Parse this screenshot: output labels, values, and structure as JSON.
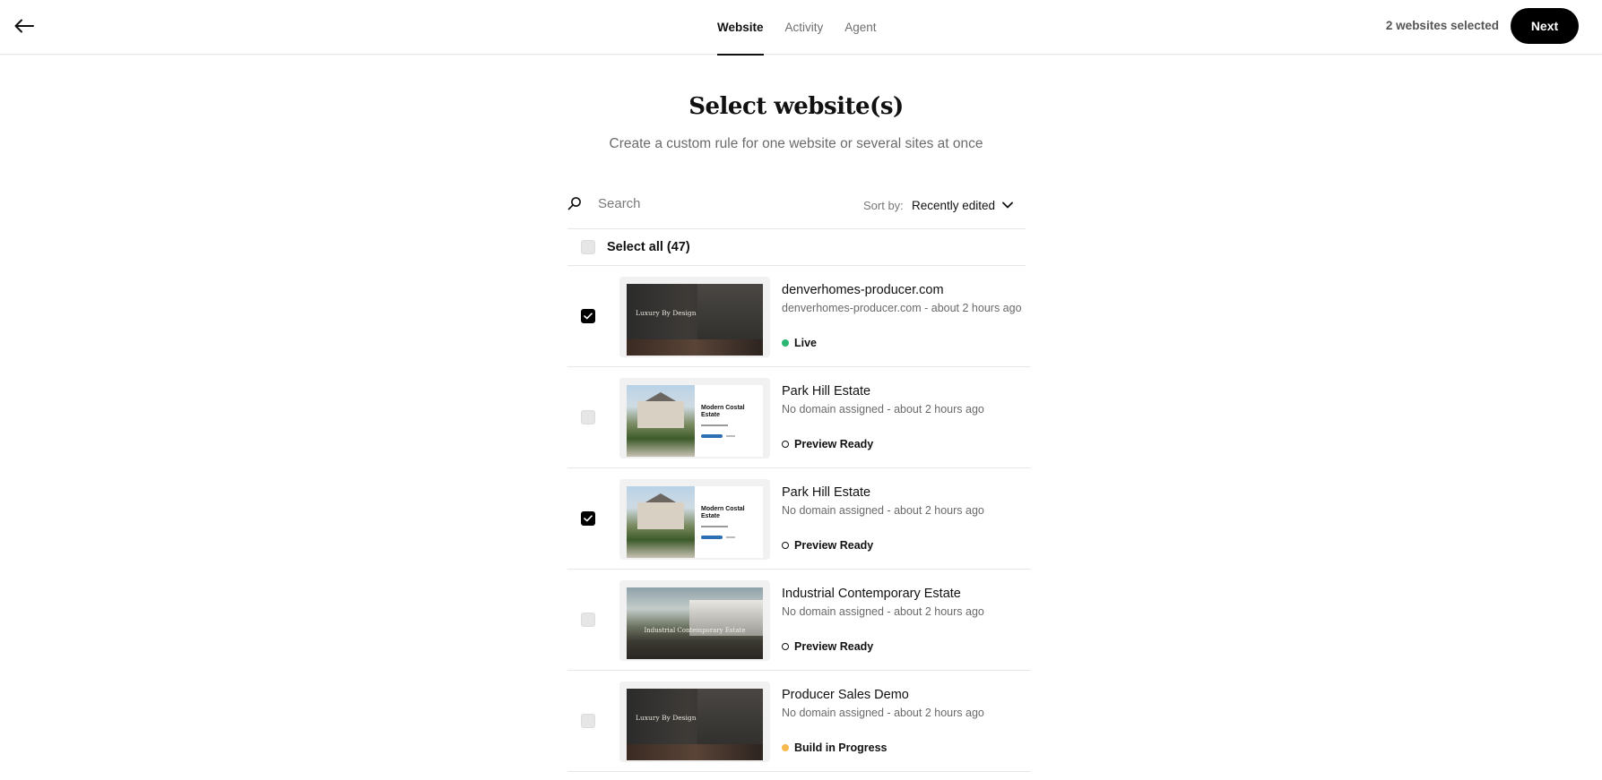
{
  "header": {
    "back_icon": "arrow-left-icon",
    "tabs": [
      {
        "label": "Website",
        "active": true
      },
      {
        "label": "Activity",
        "active": false
      },
      {
        "label": "Agent",
        "active": false
      }
    ],
    "selected_count": "2 websites selected",
    "next_label": "Next"
  },
  "page": {
    "title": "Select website(s)",
    "subtitle": "Create a custom rule for one website or several sites at once"
  },
  "search": {
    "icon": "search-icon",
    "placeholder": "Search",
    "value": ""
  },
  "sort": {
    "label": "Sort by:",
    "value": "Recently edited",
    "icon": "chevron-down-icon"
  },
  "select_all": {
    "label": "Select all (47)",
    "checked": false
  },
  "websites": [
    {
      "name": "denverhomes-producer.com",
      "meta": "denverhomes-producer.com - about 2 hours ago",
      "status": "Live",
      "status_color": "#2bb673",
      "checked": true,
      "thumbnail_text": "Luxury By Design"
    },
    {
      "name": "Park Hill Estate",
      "meta": "No domain assigned - about 2 hours ago",
      "status": "Preview Ready",
      "status_color": "#111111",
      "checked": false,
      "thumbnail_text": "Modern Costal Estate"
    },
    {
      "name": "Park Hill Estate",
      "meta": "No domain assigned - about 2 hours ago",
      "status": "Preview Ready",
      "status_color": "#111111",
      "checked": true,
      "thumbnail_text": "Modern Costal Estate"
    },
    {
      "name": "Industrial Contemporary Estate",
      "meta": "No domain assigned - about 2 hours ago",
      "status": "Preview Ready",
      "status_color": "#111111",
      "checked": false,
      "thumbnail_text": "Industrial Contemporary Estate"
    },
    {
      "name": "Producer Sales Demo",
      "meta": "No domain assigned - about 2 hours ago",
      "status": "Build in Progress",
      "status_color": "#f6b84f",
      "checked": false,
      "thumbnail_text": "Luxury By Design"
    }
  ],
  "colors": {
    "accent": "#000000",
    "live": "#2bb673",
    "in_progress": "#f6b84f",
    "muted_text": "#6b6b6b"
  }
}
